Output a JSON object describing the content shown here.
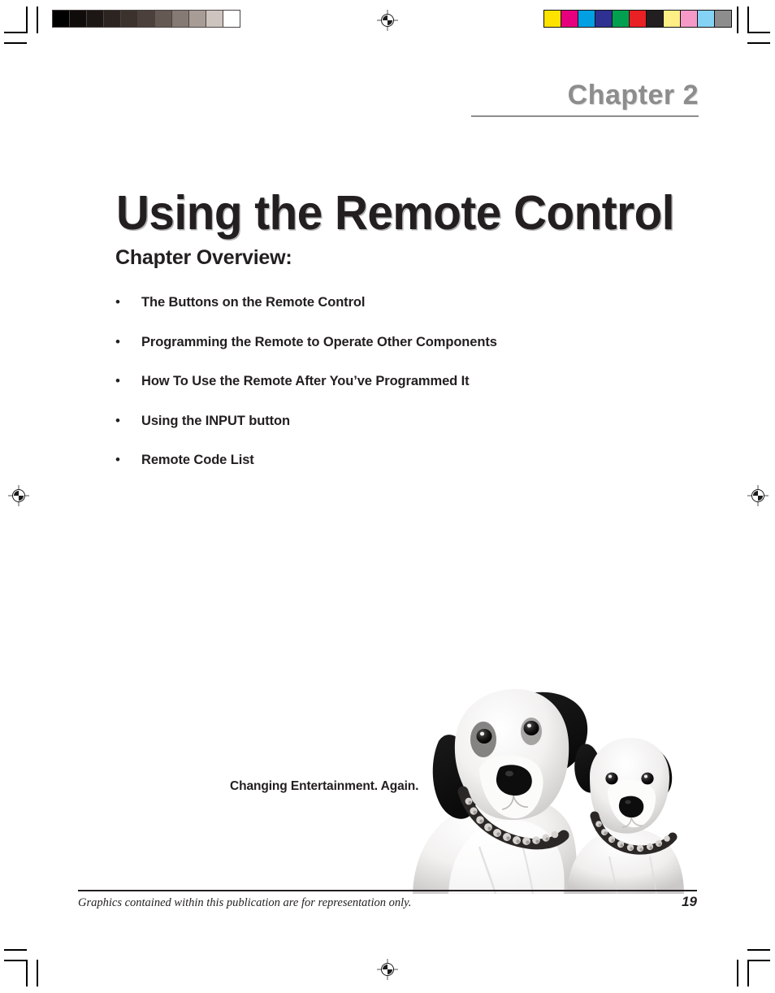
{
  "document": {
    "chapter_label": "Chapter 2",
    "title": "Using the Remote Control",
    "overview_heading": "Chapter Overview:",
    "bullet_marker": "•",
    "overview_items": [
      "The Buttons on the Remote Control",
      "Programming the Remote to Operate Other Components",
      "How To Use the Remote After You’ve Programmed It",
      "Using the INPUT button",
      "Remote Code List"
    ],
    "tagline": "Changing Entertainment. Again.",
    "footer_note": "Graphics contained within this publication are for representation only.",
    "page_number": "19"
  },
  "photo": {
    "caption": "two-dogs-photo",
    "description": "Black and white photograph of two Jack Russell terrier dogs wearing studded collars"
  },
  "print_marks": {
    "grayscale_bar": [
      "#000000",
      "#100c0c",
      "#1c1715",
      "#2b2421",
      "#3b322e",
      "#4b403b",
      "#655953",
      "#857a74",
      "#a79c96",
      "#cdc4bf",
      "#ffffff"
    ],
    "color_bar": [
      "#fee300",
      "#e6007e",
      "#00a0e3",
      "#2e3191",
      "#00a050",
      "#e92024",
      "#231f20",
      "#fdee85",
      "#f599c8",
      "#84d2f4",
      "#8d8d8d"
    ],
    "registration_mark_label": "registration-target"
  },
  "colors": {
    "chapter_gray": "#8d8d8d",
    "text_black": "#231f20",
    "page_background": "#ffffff"
  }
}
